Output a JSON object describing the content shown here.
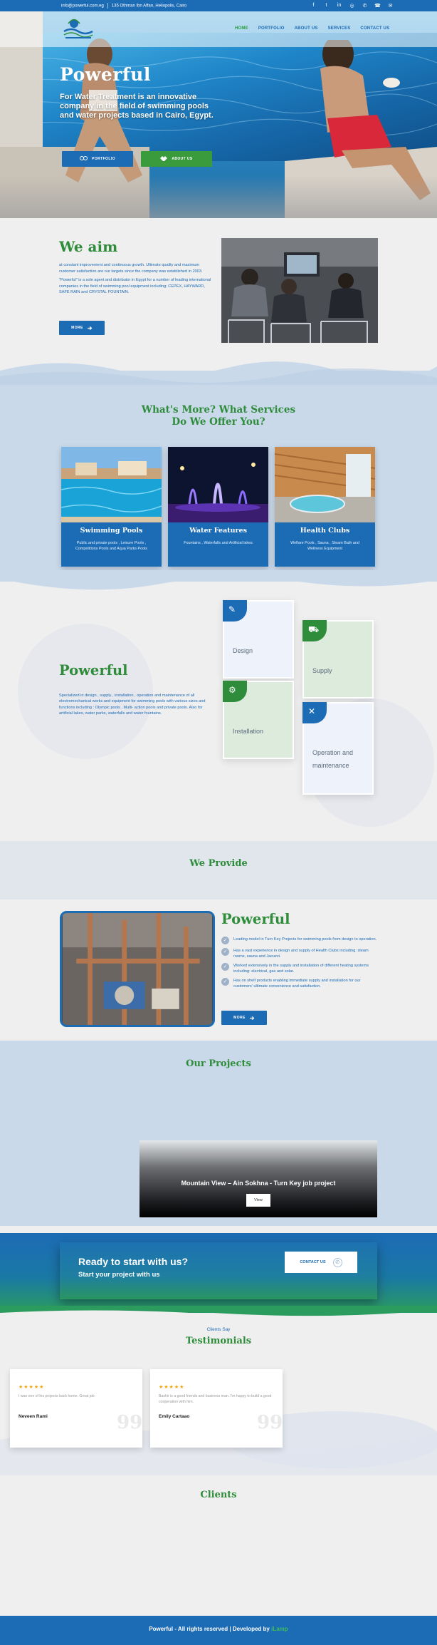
{
  "topbar": {
    "email": "info@powerful.com.eg",
    "address": "135 Othman Ibn Affan, Heliopolis, Cairo",
    "social_icons": [
      "facebook-icon",
      "twitter-icon",
      "linkedin-icon",
      "instagram-icon",
      "whatsapp-icon",
      "phone-icon",
      "email-icon"
    ]
  },
  "nav": {
    "items": [
      "HOME",
      "PORTFOLIO",
      "ABOUT US",
      "SERVICES",
      "CONTACT US"
    ],
    "active_index": 0
  },
  "hero": {
    "title": "Powerful",
    "subtitle": "For Water Treatment is an innovative company in the field of swimming pools and water projects based in Cairo, Egypt.",
    "btn_portfolio": "PORTFOLIO",
    "btn_about": "ABOUT US"
  },
  "aim": {
    "title": "We aim",
    "p1": "at constant improvement and continuous growth. Ultimate quality and maximum customer satisfaction are our targets since the company was established in 2003.",
    "p2": "\"Powerful\" is a sole agent and distributor in Egypt for a number of leading international companies in the field of swimming pool equipment including: CEPEX, HAYWARD, SAFE RAIN and CRYSTAL FOUNTAIN.",
    "more": "MORE"
  },
  "services": {
    "title_line1": "What's More? What Services",
    "title_line2": "Do We Offer You?",
    "cards": [
      {
        "title": "Swimming Pools",
        "desc": "Public and private pools , Leisure Pools , Competitions Pools and Aqua Parks Pools"
      },
      {
        "title": "Water Features",
        "desc": "Fountains , Waterfalls and Artificial lakes"
      },
      {
        "title": "Health Clubs",
        "desc": "Welfare Pools , Sauna , Steam Bath and Wellness Equipment"
      }
    ]
  },
  "powerful": {
    "title": "Powerful",
    "text": "Specialized in design , supply , installation , operation and maintenance of all electromechanical works and equipment for swimming pools with various sizes and functions including : Olympic pools , Multi- action pools and private pools. Also for artificial lakes, water parks, waterfalls and water fountains.",
    "cards": [
      "Design",
      "Supply",
      "Installation",
      "Operation and maintenance"
    ]
  },
  "provide": {
    "title": "We Provide",
    "heading": "Powerful",
    "items": [
      "Leading model in Turn Key Projects for swimming pools from design to operation.",
      "Has a vast experience in design and supply of Health Clubs including: steam rooms, sauna and Jacuzzi.",
      "Worked extensively in the supply and installation  of different heating systems including: electrical, gas and solar.",
      "Has on shelf products enabling immediate supply and installation for our customers' ultimate convenience and satisfaction."
    ],
    "more": "MORE"
  },
  "projects": {
    "title": "Our Projects",
    "card_title": "Mountain View – Ain Sokhna - Turn Key job project",
    "view": "View"
  },
  "cta": {
    "heading": "Ready to start with us?",
    "sub": "Start your project with us",
    "button": "CONTACT US"
  },
  "testimonials": {
    "small": "Clients Say",
    "title": "Testimonials",
    "items": [
      {
        "stars": "★★★★★",
        "quote": "I was one of his projects back home. Great job",
        "name": "Neveen Rami"
      },
      {
        "stars": "★★★★★",
        "quote": "Bashir is a good friends and business man. I'm happy to build a good cooperation with him.",
        "name": "Emily Cartaao"
      }
    ]
  },
  "clients": {
    "title": "Clients"
  },
  "footer": {
    "text": "Powerful - All rights reserved | Developed by ",
    "brand": "iLamp"
  },
  "colors": {
    "primary": "#1c6bb5",
    "accent": "#2e8c3b",
    "green_button": "#3a9b3c",
    "star": "#f4a20a"
  }
}
